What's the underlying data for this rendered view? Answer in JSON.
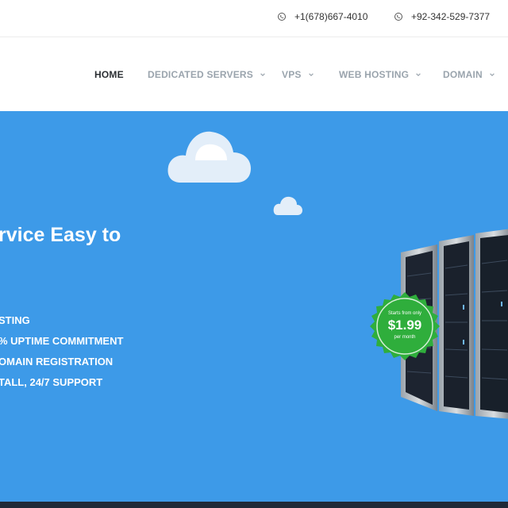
{
  "topbar": {
    "phones": [
      {
        "icon": "whatsapp-icon",
        "number": "+1(678)667-4010"
      },
      {
        "icon": "whatsapp-icon",
        "number": "+92-342-529-7377"
      }
    ]
  },
  "nav": {
    "items": [
      {
        "label": "HOME",
        "active": true,
        "dropdown": false
      },
      {
        "label": "DEDICATED SERVERS",
        "active": false,
        "dropdown": true
      },
      {
        "label": "VPS",
        "active": false,
        "dropdown": true
      },
      {
        "label": "WEB HOSTING",
        "active": false,
        "dropdown": true
      },
      {
        "label": "DOMAIN",
        "active": false,
        "dropdown": true
      }
    ]
  },
  "hero": {
    "headline": "rvice Easy to",
    "features": [
      "STING",
      "% UPTIME COMMITMENT",
      "OMAIN REGISTRATION",
      "TALL, 24/7 SUPPORT"
    ],
    "badge": {
      "top_text": "Starts from only",
      "price": "$1.99",
      "bottom_text": "per month"
    }
  },
  "colors": {
    "hero_bg": "#3d9ae8",
    "badge_green": "#2fae3c",
    "nav_active": "#2b2f33",
    "nav_inactive": "#9aa4ad",
    "footer": "#1f2a38"
  }
}
